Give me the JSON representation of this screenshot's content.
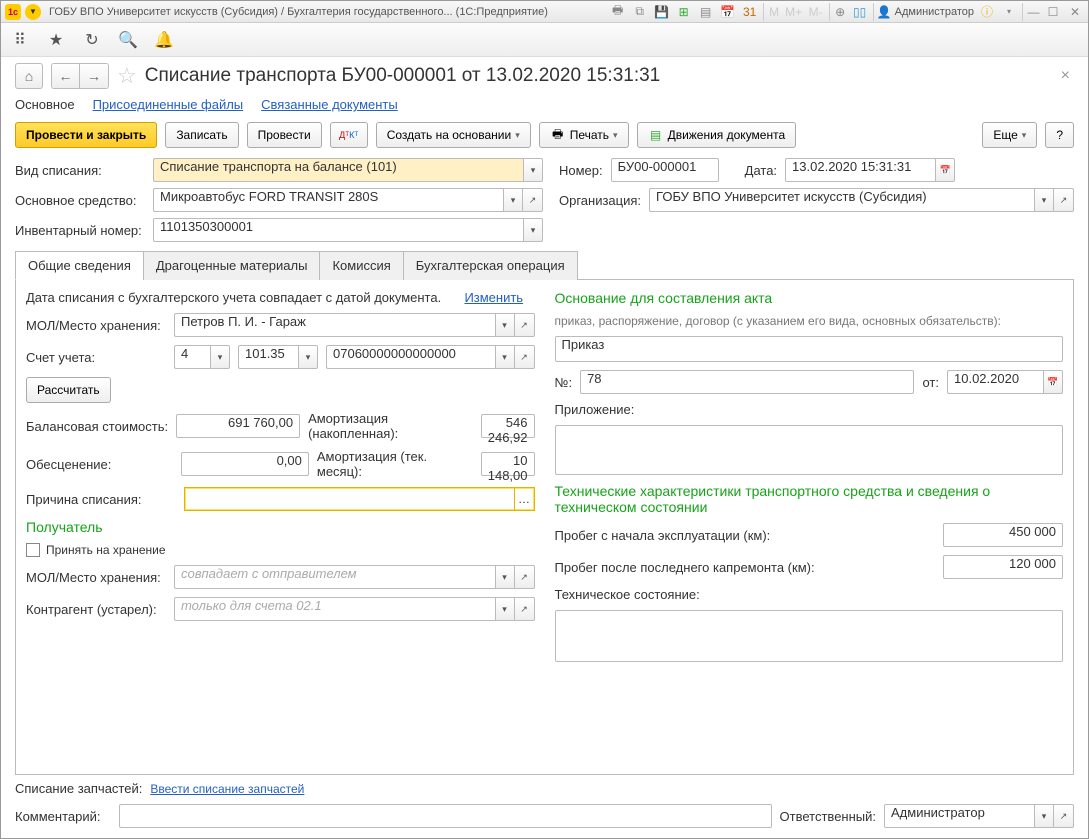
{
  "titlebar": {
    "title": "ГОБУ ВПО Университет искусств (Субсидия) / Бухгалтерия государственного... (1С:Предприятие)",
    "user_label": "Администратор"
  },
  "page": {
    "title": "Списание транспорта БУ00-000001 от 13.02.2020 15:31:31"
  },
  "subnav": {
    "main": "Основное",
    "files": "Присоединенные файлы",
    "related": "Связанные документы"
  },
  "actions": {
    "post_close": "Провести и закрыть",
    "save": "Записать",
    "post": "Провести",
    "create_based": "Создать на основании",
    "print": "Печать",
    "movements": "Движения документа",
    "more": "Еще",
    "help": "?"
  },
  "labels": {
    "writeoff_type": "Вид списания:",
    "number": "Номер:",
    "date": "Дата:",
    "asset": "Основное средство:",
    "org": "Организация:",
    "inv_num": "Инвентарный номер:",
    "mol": "МОЛ/Место хранения:",
    "account": "Счет учета:",
    "calc": "Рассчитать",
    "book_value": "Балансовая стоимость:",
    "depr_accum": "Амортизация (накопленная):",
    "impair": "Обесценение:",
    "depr_month": "Амортизация (тек. месяц):",
    "reason": "Причина списания:",
    "recipient": "Получатель",
    "take_custody": "Принять на хранение",
    "mol2": "МОЛ/Место хранения:",
    "counterparty": "Контрагент (устарел):",
    "basis_title": "Основание для составления акта",
    "basis_hint": "приказ, распоряжение, договор (с указанием его вида, основных обязательств):",
    "basis_num": "№:",
    "basis_from": "от:",
    "attachment": "Приложение:",
    "tech_title": "Технические характеристики транспортного средства и сведения о техническом состоянии",
    "mileage_start": "Пробег с начала эксплуатации (км):",
    "mileage_repair": "Пробег после последнего капремонта (км):",
    "tech_state": "Техническое состояние:",
    "parts": "Списание запчастей:",
    "parts_link": "Ввести списание запчастей",
    "comment": "Комментарий:",
    "responsible": "Ответственный:",
    "date_hint": "Дата списания с бухгалтерского учета совпадает с датой документа.",
    "change": "Изменить",
    "ph_sender": "совпадает с отправителем",
    "ph_account": "только для счета 02.1"
  },
  "tabs": {
    "general": "Общие сведения",
    "precious": "Драгоценные материалы",
    "commission": "Комиссия",
    "accounting": "Бухгалтерская операция"
  },
  "values": {
    "writeoff_type": "Списание транспорта на балансе (101)",
    "number": "БУ00-000001",
    "date": "13.02.2020 15:31:31",
    "asset": "Микроавтобус FORD TRANSIT 280S",
    "org": "ГОБУ ВПО Университет искусств (Субсидия)",
    "inv_num": "1101350300001",
    "mol": "Петров П. И. - Гараж",
    "acc1": "4",
    "acc2": "101.35",
    "acc3": "07060000000000000",
    "book_value": "691 760,00",
    "depr_accum": "546 246,92",
    "impair": "0,00",
    "depr_month": "10 148,00",
    "basis_text": "Приказ",
    "basis_num": "78",
    "basis_date": "10.02.2020",
    "mileage_start": "450 000",
    "mileage_repair": "120 000",
    "responsible": "Администратор"
  }
}
